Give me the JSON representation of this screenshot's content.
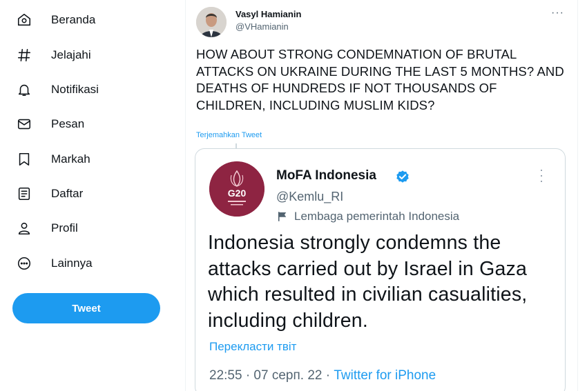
{
  "sidebar": {
    "items": [
      {
        "label": "Beranda",
        "icon": "home-icon"
      },
      {
        "label": "Jelajahi",
        "icon": "hashtag-icon"
      },
      {
        "label": "Notifikasi",
        "icon": "bell-icon"
      },
      {
        "label": "Pesan",
        "icon": "envelope-icon"
      },
      {
        "label": "Markah",
        "icon": "bookmark-icon"
      },
      {
        "label": "Daftar",
        "icon": "list-icon"
      },
      {
        "label": "Profil",
        "icon": "person-icon"
      },
      {
        "label": "Lainnya",
        "icon": "more-circle-icon"
      }
    ],
    "tweet_button": "Tweet"
  },
  "tweet": {
    "author_name": "Vasyl Hamianin",
    "author_handle": "@VHamianin",
    "more": "···",
    "text": "HOW ABOUT STRONG CONDEMNATION OF BRUTAL ATTACKS ON UKRAINE DURING THE LAST 5 MONTHS? AND DEATHS OF HUNDREDS IF NOT THOUSANDS OF CHILDREN, INCLUDING MUSLIM KIDS?",
    "translate_link": "Terjemahkan Tweet"
  },
  "embedded": {
    "name": "MoFA Indonesia",
    "handle": "@Kemlu_RI",
    "label": "Lembaga pemerintah Indonesia",
    "avatar_text": "G20",
    "text": "Indonesia strongly condemns the attacks carried out by Israel in Gaza  which resulted in civilian casualities, including children.",
    "translate_link": "Перекласти твіт",
    "time": "22:55 · 07 серп. 22 · ",
    "source": "Twitter for iPhone"
  },
  "colors": {
    "accent": "#1d9bf0",
    "text": "#0f1419",
    "muted": "#536471",
    "border": "#cfd9de",
    "g20_avatar": "#8e2442"
  }
}
